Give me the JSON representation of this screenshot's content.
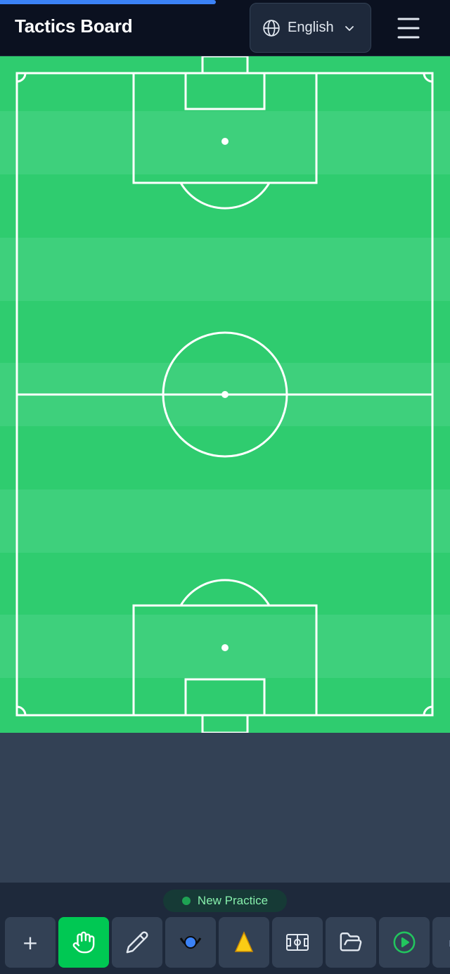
{
  "header": {
    "title": "Tactics Board",
    "language": "English",
    "progress_fraction": 0.48
  },
  "icons": {
    "language": "globe-icon",
    "language_dropdown": "chevron-down-icon",
    "menu": "hamburger-menu-icon"
  },
  "pitch": {
    "orientation": "vertical",
    "colors": {
      "stripe_dark": "#2fcc6f",
      "stripe_light": "#3ed07c",
      "lines": "#ffffff"
    }
  },
  "practice": {
    "name": "New Practice",
    "status_color": "#22c55e"
  },
  "toolbar": {
    "tools": [
      {
        "name": "add",
        "icon": "plus-icon",
        "label": "+",
        "active": false
      },
      {
        "name": "move",
        "icon": "hand-icon",
        "active": true
      },
      {
        "name": "draw",
        "icon": "pencil-icon",
        "active": false
      },
      {
        "name": "ball",
        "icon": "player-marker-icon",
        "active": false
      },
      {
        "name": "cone",
        "icon": "cone-icon",
        "active": false
      },
      {
        "name": "field",
        "icon": "field-icon",
        "active": false
      },
      {
        "name": "open",
        "icon": "folder-open-icon",
        "active": false
      },
      {
        "name": "play",
        "icon": "play-icon",
        "active": false
      },
      {
        "name": "more",
        "icon": "partial-icon",
        "active": false
      }
    ],
    "colors": {
      "active": "#00c853",
      "button": "#334155",
      "bar": "#1e293b"
    }
  }
}
